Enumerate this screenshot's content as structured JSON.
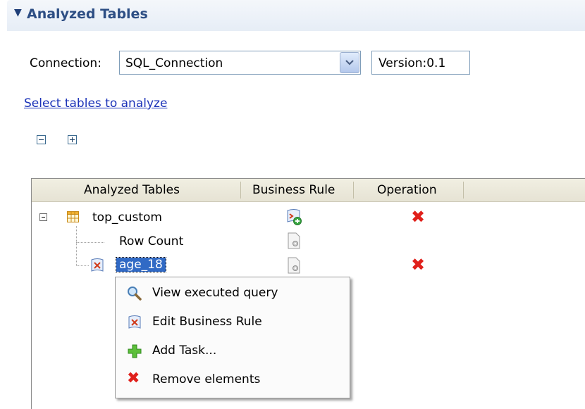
{
  "section": {
    "title": "Analyzed Tables"
  },
  "connection": {
    "label": "Connection:",
    "selected": "SQL_Connection",
    "version": "Version:0.1"
  },
  "select_link": "Select tables to analyze",
  "table": {
    "columns": [
      "Analyzed Tables",
      "Business Rule",
      "Operation"
    ],
    "rows": [
      {
        "label": "top_custom",
        "business_rule_icon": "add-business-rule-icon",
        "operation_icon": "delete-icon"
      },
      {
        "label": "Row Count",
        "business_rule_icon": "settings-icon",
        "operation_icon": ""
      },
      {
        "label": "age_18",
        "business_rule_icon": "settings-icon",
        "operation_icon": "delete-icon"
      }
    ]
  },
  "context_menu": {
    "items": [
      {
        "label": "View executed query",
        "icon": "magnifier-icon"
      },
      {
        "label": "Edit Business Rule",
        "icon": "business-rule-icon"
      },
      {
        "label": "Add Task...",
        "icon": "green-plus-icon"
      },
      {
        "label": "Remove elements",
        "icon": "red-x-icon"
      }
    ]
  },
  "colors": {
    "section_title": "#2d4e84",
    "link": "#1b32b8",
    "selection": "#316ac5",
    "delete": "#e0201b"
  }
}
